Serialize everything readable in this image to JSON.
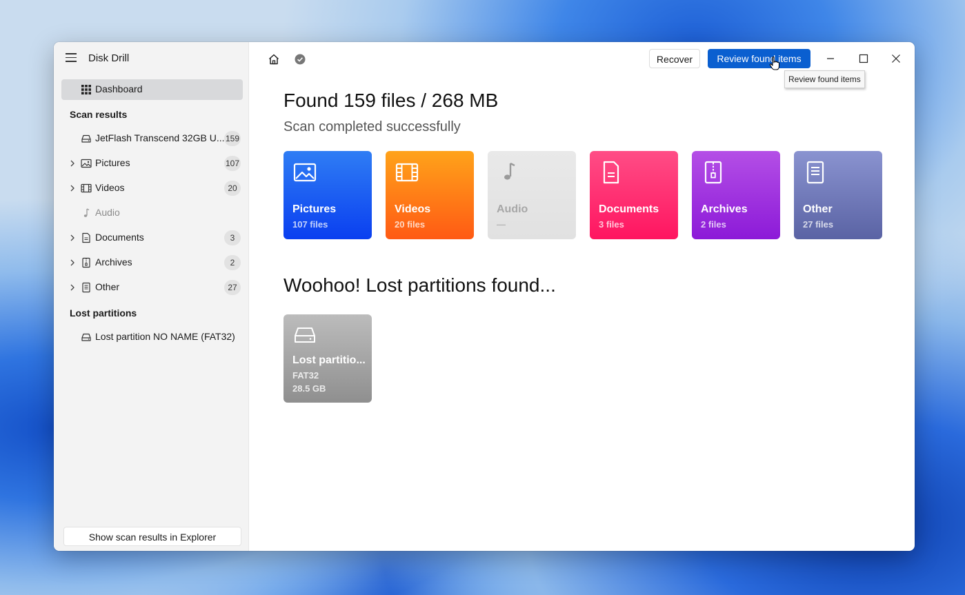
{
  "app": {
    "title": "Disk Drill"
  },
  "sidebar": {
    "dashboard_label": "Dashboard",
    "scan_results_heading": "Scan results",
    "items": [
      {
        "label": "JetFlash Transcend 32GB U...",
        "count": "159",
        "icon": "drive-icon",
        "expandable": false
      },
      {
        "label": "Pictures",
        "count": "107",
        "icon": "image-icon",
        "expandable": true
      },
      {
        "label": "Videos",
        "count": "20",
        "icon": "film-icon",
        "expandable": true
      },
      {
        "label": "Audio",
        "count": "",
        "icon": "music-note-icon",
        "expandable": false
      },
      {
        "label": "Documents",
        "count": "3",
        "icon": "document-icon",
        "expandable": true
      },
      {
        "label": "Archives",
        "count": "2",
        "icon": "archive-icon",
        "expandable": true
      },
      {
        "label": "Other",
        "count": "27",
        "icon": "file-icon",
        "expandable": true
      }
    ],
    "lost_partitions_heading": "Lost partitions",
    "lost_partition_item": "Lost partition NO NAME (FAT32)",
    "explorer_button": "Show scan results in Explorer"
  },
  "toolbar": {
    "recover_label": "Recover",
    "review_label": "Review found items",
    "tooltip": "Review found items"
  },
  "main": {
    "title": "Found 159 files / 268 MB",
    "subtitle": "Scan completed successfully",
    "categories": [
      {
        "name": "Pictures",
        "count": "107 files",
        "color_from": "#2f7df4",
        "color_to": "#0a3ff0",
        "icon": "image-icon"
      },
      {
        "name": "Videos",
        "count": "20 files",
        "color_from": "#ffa31a",
        "color_to": "#ff5a14",
        "icon": "film-icon"
      },
      {
        "name": "Audio",
        "count": "—",
        "color_from": "#e9e9e9",
        "color_to": "#e1e1e1",
        "icon": "music-note-icon"
      },
      {
        "name": "Documents",
        "count": "3 files",
        "color_from": "#ff4d86",
        "color_to": "#ff1560",
        "icon": "document-icon"
      },
      {
        "name": "Archives",
        "count": "2 files",
        "color_from": "#b44fe6",
        "color_to": "#8c1ad8",
        "icon": "archive-icon"
      },
      {
        "name": "Other",
        "count": "27 files",
        "color_from": "#8a93d0",
        "color_to": "#5a63a4",
        "icon": "file-icon"
      }
    ],
    "lost_title": "Woohoo! Lost partitions found...",
    "partition": {
      "name": "Lost partitio...",
      "fs": "FAT32",
      "size": "28.5 GB"
    }
  }
}
